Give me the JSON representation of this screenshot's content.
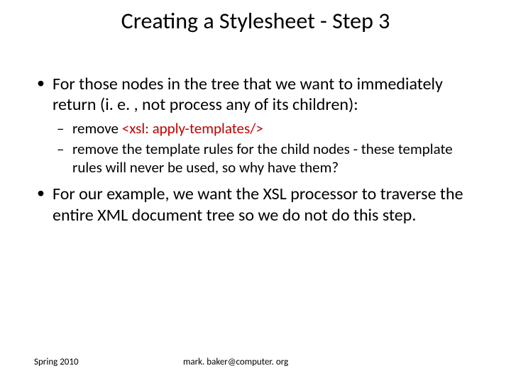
{
  "title": "Creating a Stylesheet - Step 3",
  "bullets": {
    "b1_pre": "For those nodes in the tree that we want to immediately return (i. e. , ",
    "b1_not": "not",
    "b1_post": " process any of its children):",
    "b1a_pre": "remove ",
    "b1a_code": "<xsl: apply-templates/>",
    "b1b": "remove the template rules for the child nodes - these template rules will never be used, so why have them?",
    "b2_pre": "For our example, we want the XSL processor to traverse the entire XML document tree so we do ",
    "b2_not": "not",
    "b2_post": " do this step."
  },
  "footer": {
    "term": "Spring 2010",
    "email": "mark. baker@computer. org"
  }
}
